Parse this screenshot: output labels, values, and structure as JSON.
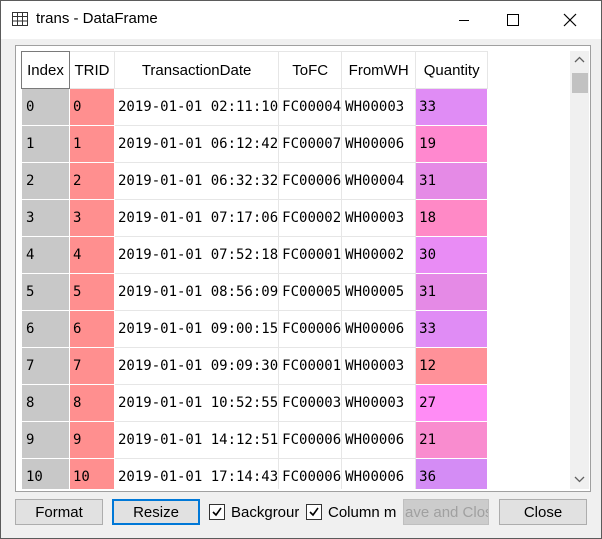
{
  "window": {
    "title": "trans - DataFrame"
  },
  "table": {
    "columns": [
      "Index",
      "TRID",
      "TransactionDate",
      "ToFC",
      "FromWH",
      "Quantity"
    ],
    "rows": [
      {
        "index": "0",
        "trid": "0",
        "date": "2019-01-01 02:11:10",
        "tofc": "FC00004",
        "fromwh": "WH00003",
        "qty": "33",
        "qty_color": "#e08cf5",
        "trid_color": "#ff8f8f"
      },
      {
        "index": "1",
        "trid": "1",
        "date": "2019-01-01 06:12:42",
        "tofc": "FC00007",
        "fromwh": "WH00006",
        "qty": "19",
        "qty_color": "#ff88cf",
        "trid_color": "#ff8f8f"
      },
      {
        "index": "2",
        "trid": "2",
        "date": "2019-01-01 06:32:32",
        "tofc": "FC00006",
        "fromwh": "WH00004",
        "qty": "31",
        "qty_color": "#e58ae6",
        "trid_color": "#ff8f8f"
      },
      {
        "index": "3",
        "trid": "3",
        "date": "2019-01-01 07:17:06",
        "tofc": "FC00002",
        "fromwh": "WH00003",
        "qty": "18",
        "qty_color": "#ff89c6",
        "trid_color": "#ff8f8f"
      },
      {
        "index": "4",
        "trid": "4",
        "date": "2019-01-01 07:52:18",
        "tofc": "FC00001",
        "fromwh": "WH00002",
        "qty": "30",
        "qty_color": "#e98cf5",
        "trid_color": "#ff8f8f"
      },
      {
        "index": "5",
        "trid": "5",
        "date": "2019-01-01 08:56:09",
        "tofc": "FC00005",
        "fromwh": "WH00005",
        "qty": "31",
        "qty_color": "#e58ae6",
        "trid_color": "#ff8f8f"
      },
      {
        "index": "6",
        "trid": "6",
        "date": "2019-01-01 09:00:15",
        "tofc": "FC00006",
        "fromwh": "WH00006",
        "qty": "33",
        "qty_color": "#e08cf5",
        "trid_color": "#ff8f8f"
      },
      {
        "index": "7",
        "trid": "7",
        "date": "2019-01-01 09:09:30",
        "tofc": "FC00001",
        "fromwh": "WH00003",
        "qty": "12",
        "qty_color": "#ff9199",
        "trid_color": "#ff8f8f"
      },
      {
        "index": "8",
        "trid": "8",
        "date": "2019-01-01 10:52:55",
        "tofc": "FC00003",
        "fromwh": "WH00003",
        "qty": "27",
        "qty_color": "#ff8cf5",
        "trid_color": "#ff8f8f"
      },
      {
        "index": "9",
        "trid": "9",
        "date": "2019-01-01 14:12:51",
        "tofc": "FC00006",
        "fromwh": "WH00006",
        "qty": "21",
        "qty_color": "#f98ccf",
        "trid_color": "#ff8f8f"
      },
      {
        "index": "10",
        "trid": "10",
        "date": "2019-01-01 17:14:43",
        "tofc": "FC00006",
        "fromwh": "WH00006",
        "qty": "36",
        "qty_color": "#d48cf5",
        "trid_color": "#ff8f8f"
      }
    ]
  },
  "buttons": {
    "format": "Format",
    "resize": "Resize",
    "background": "Backgrour",
    "column_min": "Column mi",
    "save_close": "ave and Clos",
    "close": "Close"
  },
  "checkboxes": {
    "background_checked": true,
    "column_min_checked": true
  },
  "colors": {
    "accent": "#0078d7",
    "index_bg": "#c8c8c8",
    "trid_bg": "#ff8f8f"
  }
}
